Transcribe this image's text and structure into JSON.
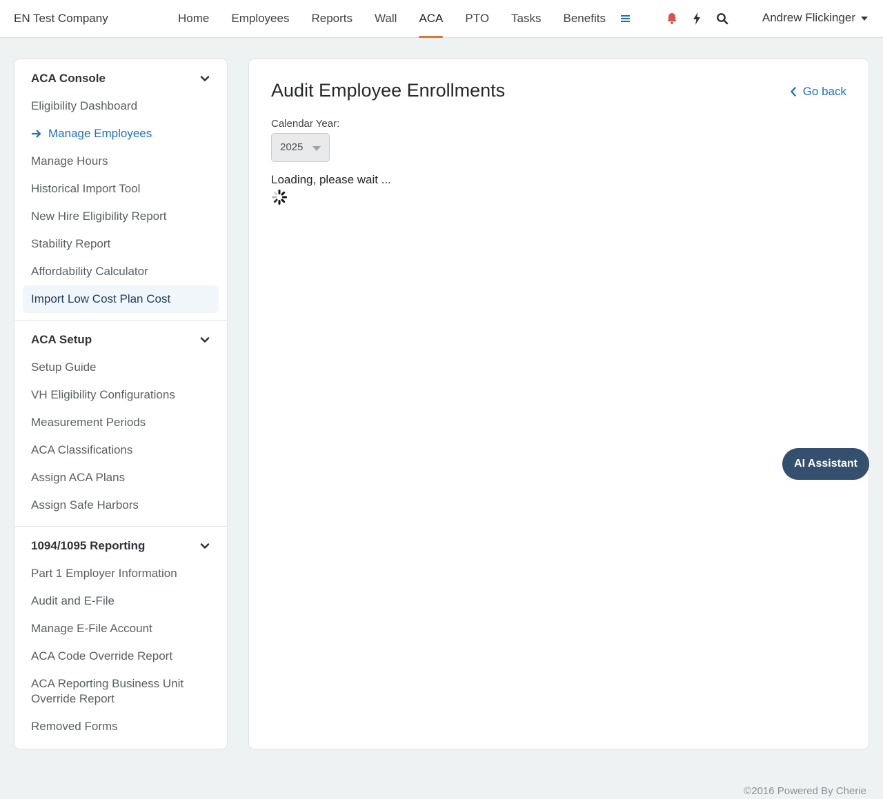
{
  "header": {
    "company": "EN Test Company",
    "nav": [
      {
        "label": "Home"
      },
      {
        "label": "Employees"
      },
      {
        "label": "Reports"
      },
      {
        "label": "Wall"
      },
      {
        "label": "ACA",
        "active": true
      },
      {
        "label": "PTO"
      },
      {
        "label": "Tasks"
      },
      {
        "label": "Benefits"
      }
    ],
    "icons": [
      "menu-icon",
      "bell-icon",
      "lightning-icon",
      "search-icon"
    ],
    "user_name": "Andrew Flickinger",
    "accent_color": "#e0772f",
    "bell_color": "#d9534f"
  },
  "sidebar": {
    "sections": [
      {
        "title": "ACA Console",
        "items": [
          {
            "label": "Eligibility Dashboard"
          },
          {
            "label": "Manage Employees",
            "current": true
          },
          {
            "label": "Manage Hours"
          },
          {
            "label": "Historical Import Tool"
          },
          {
            "label": "New Hire Eligibility Report"
          },
          {
            "label": "Stability Report"
          },
          {
            "label": "Affordability Calculator"
          },
          {
            "label": "Import Low Cost Plan Cost",
            "hovered": true
          }
        ]
      },
      {
        "title": "ACA Setup",
        "items": [
          {
            "label": "Setup Guide"
          },
          {
            "label": "VH Eligibility Configurations"
          },
          {
            "label": "Measurement Periods"
          },
          {
            "label": "ACA Classifications"
          },
          {
            "label": "Assign ACA Plans"
          },
          {
            "label": "Assign Safe Harbors"
          }
        ]
      },
      {
        "title": "1094/1095 Reporting",
        "items": [
          {
            "label": "Part 1 Employer Information"
          },
          {
            "label": "Audit and E-File"
          },
          {
            "label": "Manage E-File Account"
          },
          {
            "label": "ACA Code Override Report"
          },
          {
            "label": "ACA Reporting Business Unit Override Report"
          },
          {
            "label": "Removed Forms"
          }
        ]
      }
    ]
  },
  "main": {
    "title": "Audit Employee Enrollments",
    "go_back": "Go back",
    "calendar_year_label": "Calendar Year:",
    "calendar_year_value": "2025",
    "loading_text": "Loading, please wait ..."
  },
  "ai_assistant_label": "AI Assistant",
  "footer_text": "©2016 Powered By Cherie",
  "link_color": "#1f6fc1"
}
